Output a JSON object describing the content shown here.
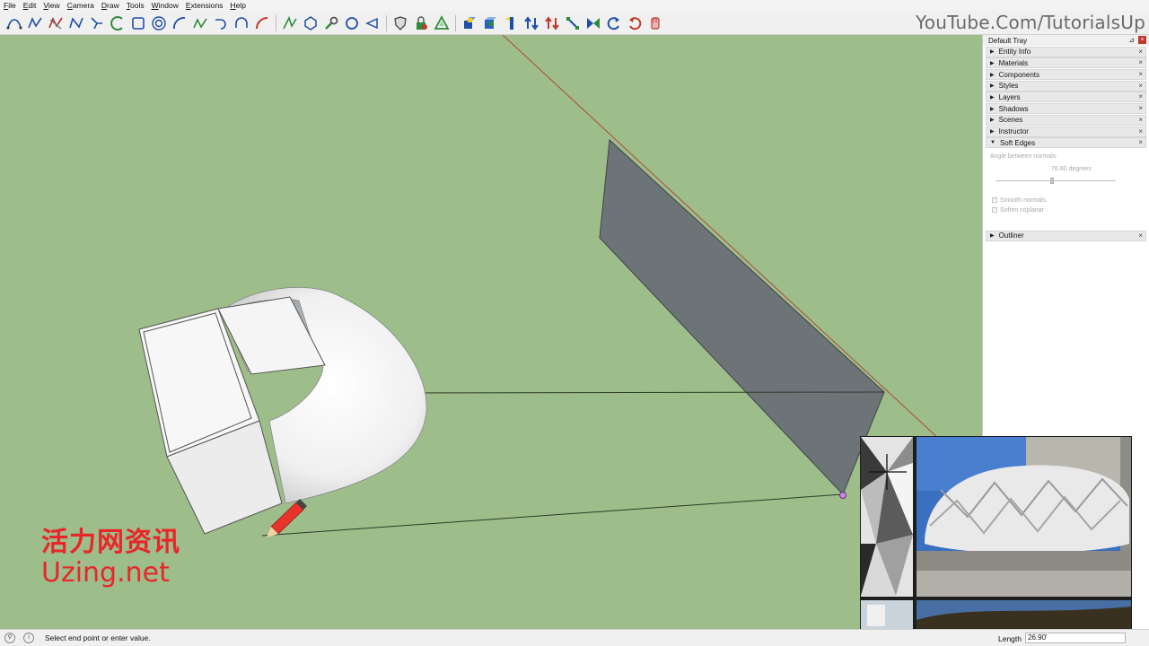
{
  "menu": [
    "File",
    "Edit",
    "View",
    "Camera",
    "Draw",
    "Tools",
    "Window",
    "Extensions",
    "Help"
  ],
  "toolbar": {
    "watermark": "YouTube.Com/TutorialsUp",
    "icons": [
      "bezier-curve",
      "freehand-line",
      "shape-bender",
      "polyline",
      "bezier-spline",
      "arc-green",
      "rectangle",
      "offset-circle",
      "arc-blue",
      "polyline-green",
      "arc-tangent",
      "arc-compound",
      "arc-red",
      "line-green",
      "polygon",
      "wrench",
      "circle",
      "lasso",
      "shield",
      "lock",
      "recycle",
      "push-pull-blue",
      "push-pull-cube",
      "extrude-vertical",
      "arrows-up-down",
      "arrows-red",
      "scale-diagonal",
      "mirror",
      "rotate-left",
      "rotate-red",
      "pointer-hand"
    ]
  },
  "tray": {
    "title": "Default Tray",
    "pin": "⊿",
    "close": "×",
    "panels": [
      "Entity Info",
      "Materials",
      "Components",
      "Styles",
      "Layers",
      "Shadows",
      "Scenes",
      "Instructor",
      "Soft Edges"
    ],
    "soft_edges": {
      "angle_label": "Angle between normals:",
      "angle_value": "76.80 degrees",
      "angle_fraction": 0.47,
      "smooth_normals": "Smooth normals",
      "soften_coplanar": "Soften coplanar"
    },
    "outliner": "Outliner"
  },
  "status": {
    "message": "Select end point or enter value.",
    "vcb_label": "Length",
    "vcb_value": "26.90'"
  },
  "logo": {
    "cn": "活力网资讯",
    "en": "Uzing.net"
  },
  "colors": {
    "viewport_bg": "#9dbd8a",
    "plane": "#6c7478",
    "logo_red": "#e8262a"
  }
}
